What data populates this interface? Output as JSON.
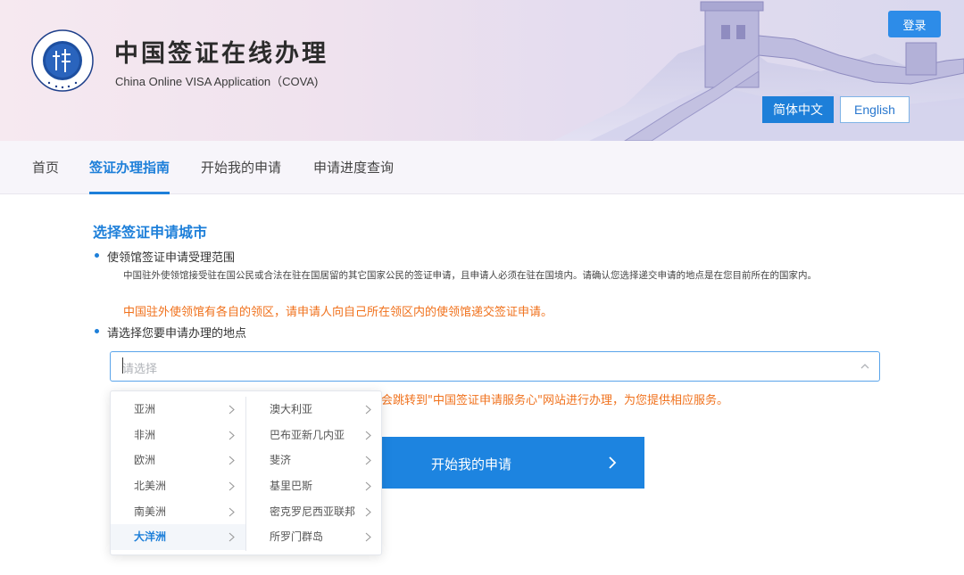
{
  "header": {
    "title": "中国签证在线办理",
    "subtitle": "China Online VISA Application（COVA)",
    "login_label": "登录",
    "lang_zh": "简体中文",
    "lang_en": "English",
    "logo_text": "CHINA CONSULAR AFFAIRS"
  },
  "nav": {
    "items": [
      {
        "label": "首页"
      },
      {
        "label": "签证办理指南"
      },
      {
        "label": "开始我的申请"
      },
      {
        "label": "申请进度查询"
      }
    ],
    "active_index": 1
  },
  "main": {
    "section_title": "选择签证申请城市",
    "bullet1": "使领馆签证申请受理范围",
    "desc": "中国驻外使领馆接受驻在国公民或合法在驻在国居留的其它国家公民的签证申请，且申请人必须在驻在国境内。请确认您选择递交申请的地点是在您目前所在的国家内。",
    "warn": "中国驻外使领馆有各自的领区，请申请人向自己所在领区内的使领馆递交签证申请。",
    "bullet2": "请选择您要申请办理的地点",
    "select_placeholder": "请选择",
    "redirect_note": "会跳转到\"中国签证申请服务心\"网站进行办理，为您提供相应服务。",
    "start_button": "开始我的申请"
  },
  "cascader": {
    "continents": [
      "亚洲",
      "非洲",
      "欧洲",
      "北美洲",
      "南美洲",
      "大洋洲"
    ],
    "active_continent_index": 5,
    "countries": [
      "澳大利亚",
      "巴布亚新几内亚",
      "斐济",
      "基里巴斯",
      "密克罗尼西亚联邦",
      "所罗门群岛"
    ]
  },
  "colors": {
    "accent": "#1d7fd9",
    "warning": "#f0711c"
  }
}
